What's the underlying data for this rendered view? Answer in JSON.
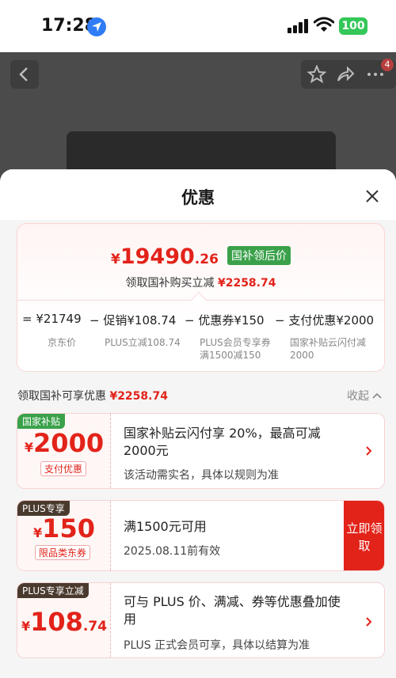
{
  "status_bar": {
    "time": "17:28",
    "battery": "100"
  },
  "nav": {
    "badge_count": "4"
  },
  "sheet": {
    "title": "优惠"
  },
  "price_card": {
    "yen": "¥",
    "price_int": "19490",
    "price_dec": ".26",
    "price_tag": "国补领后价",
    "sub_text": "领取国补购买立减",
    "sub_amount": "¥2258.74",
    "breakdown": [
      {
        "op": "=",
        "main": "¥21749",
        "sub": "京东价"
      },
      {
        "op": "−",
        "main": "促销¥108.74",
        "sub": "PLUS立减108.74"
      },
      {
        "op": "−",
        "main": "优惠券¥150",
        "sub": "PLUS会员专享券满1500减150"
      },
      {
        "op": "−",
        "main": "支付优惠¥2000",
        "sub": "国家补贴云闪付减2000"
      }
    ]
  },
  "section": {
    "title": "领取国补可享优惠",
    "amount": "¥2258.74",
    "toggle": "收起"
  },
  "coupons": [
    {
      "tag": "国家补贴",
      "tag_color": "#3aa14a",
      "yen": "¥",
      "amount": "2000",
      "decimal": "",
      "kind": "支付优惠",
      "main": "国家补贴云闪付享 20%，最高可减 2000元",
      "desc": "该活动需实名，具体以规则为准",
      "action": "chevron-right-icon"
    },
    {
      "tag": "PLUS专享",
      "tag_color": "#4a3a2e",
      "yen": "¥",
      "amount": "150",
      "decimal": "",
      "kind": "限品类东券",
      "main": "满1500元可用",
      "desc": "2025.08.11前有效",
      "action_label": "立即领取"
    },
    {
      "tag": "PLUS专享立减",
      "tag_color": "#4a3a2e",
      "yen": "¥",
      "amount": "108",
      "decimal": ".74",
      "main": "可与 PLUS 价、满减、券等优惠叠加使用",
      "desc": "PLUS 正式会员可享，具体以结算为准",
      "action": "chevron-right-icon"
    }
  ]
}
